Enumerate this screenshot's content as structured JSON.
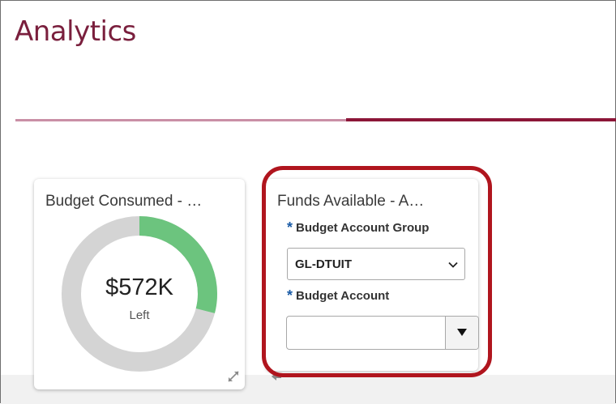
{
  "page": {
    "title": "Analytics"
  },
  "tabs_bar": {
    "accent_light": "#c98fa6",
    "accent_dark": "#8c1638"
  },
  "cards": {
    "budget_consumed": {
      "title": "Budget Consumed - …",
      "value": "$572K",
      "sublabel": "Left",
      "consumed_fraction": 0.29,
      "colors": {
        "consumed": "#6cc47e",
        "remaining": "#d4d4d4"
      },
      "expand_icon": "expand-icon"
    },
    "funds_available": {
      "title": "Funds Available - A…",
      "required_marker": "*",
      "budget_account_group": {
        "label": "Budget Account Group",
        "value": "GL-DTUIT"
      },
      "budget_account": {
        "label": "Budget Account",
        "value": ""
      },
      "collapse_icon": "collapse-left-icon"
    }
  },
  "annotation": {
    "highlight_color": "#b0151e"
  }
}
